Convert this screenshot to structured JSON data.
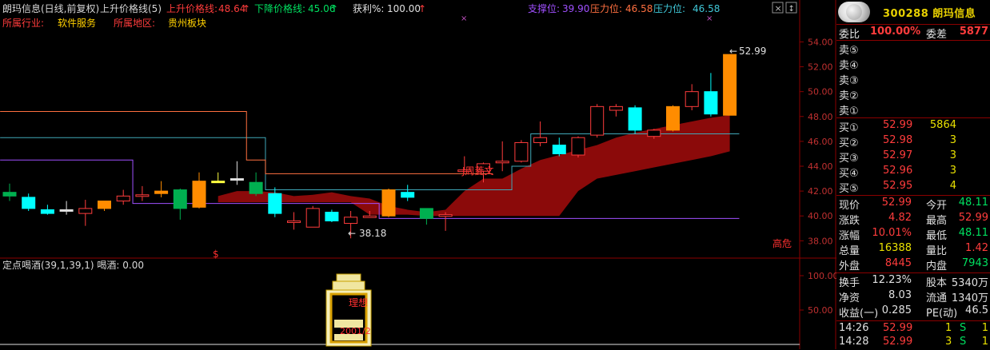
{
  "header": {
    "stock_title": "朗玛信息(日线,前复权)",
    "indicator_name": "上升价格线(5)",
    "up_price_label": "上升价格线:",
    "up_price_value": "48.64",
    "down_price_label": "下降价格线:",
    "down_price_value": "45.06",
    "profit_label": "获利%:",
    "profit_value": "100.00",
    "support_label": "支撑位:",
    "support_value": "39.90",
    "pressure_label": "压力位:",
    "pressure_value": "46.58",
    "pressure2_label": "压力位:",
    "pressure2_value": "46.58"
  },
  "info": {
    "industry_label": "所属行业:",
    "industry_value": "软件服务",
    "region_label": "所属地区:",
    "region_value": "贵州板块"
  },
  "main_axis": {
    "ticks": [
      "54.00",
      "52.00",
      "50.00",
      "48.00",
      "46.00",
      "44.00",
      "42.00",
      "40.00",
      "38.00"
    ]
  },
  "annotations": {
    "high_price": "52.99",
    "low_price": "38.18",
    "signal_text": "J周菱文",
    "danger_text": "高危",
    "dollar_mark": "$",
    "x_mark_1": "×",
    "x_mark_2": "×"
  },
  "lower_panel": {
    "title": "定点喝酒(39,1,39,1) 喝酒: 0.00",
    "axis_ticks": [
      "100.00",
      "50.00"
    ],
    "bottle_label_1": "理想",
    "bottle_label_2": "2001/2"
  },
  "chart_data": {
    "type": "candlestick",
    "ylim": [
      36.8,
      54.8
    ],
    "candles": [
      {
        "o": 41.6,
        "h": 42.6,
        "l": 41.2,
        "c": 41.9,
        "color": "green"
      },
      {
        "o": 41.5,
        "h": 41.8,
        "l": 40.4,
        "c": 40.6,
        "color": "cyan"
      },
      {
        "o": 40.5,
        "h": 40.9,
        "l": 40.1,
        "c": 40.2,
        "color": "cyan"
      },
      {
        "o": 40.5,
        "h": 41.2,
        "l": 40.1,
        "c": 40.4,
        "color": "white"
      },
      {
        "o": 40.2,
        "h": 41.3,
        "l": 39.2,
        "c": 40.6,
        "color": "red"
      },
      {
        "o": 40.6,
        "h": 41.2,
        "l": 40.4,
        "c": 41.2,
        "color": "orange"
      },
      {
        "o": 41.2,
        "h": 42.1,
        "l": 40.9,
        "c": 41.6,
        "color": "red"
      },
      {
        "o": 41.6,
        "h": 42.4,
        "l": 41.2,
        "c": 41.7,
        "color": "red"
      },
      {
        "o": 41.8,
        "h": 42.8,
        "l": 41.5,
        "c": 42.0,
        "color": "orange"
      },
      {
        "o": 42.1,
        "h": 42.2,
        "l": 39.7,
        "c": 40.6,
        "color": "green"
      },
      {
        "o": 40.7,
        "h": 43.5,
        "l": 40.6,
        "c": 42.8,
        "color": "orange"
      },
      {
        "o": 42.8,
        "h": 43.5,
        "l": 42.7,
        "c": 42.8,
        "color": "yellow"
      },
      {
        "o": 42.9,
        "h": 44.4,
        "l": 42.5,
        "c": 43.0,
        "color": "white"
      },
      {
        "o": 42.7,
        "h": 43.5,
        "l": 41.6,
        "c": 41.8,
        "color": "green"
      },
      {
        "o": 41.8,
        "h": 42.3,
        "l": 39.9,
        "c": 40.2,
        "color": "cyan"
      },
      {
        "o": 39.6,
        "h": 40.3,
        "l": 38.9,
        "c": 39.6,
        "color": "red"
      },
      {
        "o": 39.1,
        "h": 40.8,
        "l": 39.1,
        "c": 40.6,
        "color": "red"
      },
      {
        "o": 40.3,
        "h": 40.5,
        "l": 39.5,
        "c": 39.6,
        "color": "cyan"
      },
      {
        "o": 39.4,
        "h": 40.4,
        "l": 38.2,
        "c": 39.9,
        "color": "red"
      },
      {
        "o": 40.0,
        "h": 40.4,
        "l": 39.9,
        "c": 40.0,
        "color": "red"
      },
      {
        "o": 40.0,
        "h": 42.2,
        "l": 39.9,
        "c": 42.1,
        "color": "orange"
      },
      {
        "o": 41.9,
        "h": 42.5,
        "l": 41.2,
        "c": 41.5,
        "color": "cyan"
      },
      {
        "o": 40.6,
        "h": 40.6,
        "l": 39.3,
        "c": 39.8,
        "color": "green"
      },
      {
        "o": 40.0,
        "h": 40.3,
        "l": 38.8,
        "c": 40.1,
        "color": "red"
      },
      {
        "o": 43.7,
        "h": 44.8,
        "l": 43.6,
        "c": 43.7,
        "color": "red"
      },
      {
        "o": 43.6,
        "h": 44.3,
        "l": 42.7,
        "c": 44.2,
        "color": "red"
      },
      {
        "o": 44.3,
        "h": 46.0,
        "l": 43.6,
        "c": 44.4,
        "color": "red"
      },
      {
        "o": 44.4,
        "h": 46.1,
        "l": 44.3,
        "c": 45.9,
        "color": "red"
      },
      {
        "o": 45.9,
        "h": 47.6,
        "l": 45.6,
        "c": 46.3,
        "color": "red"
      },
      {
        "o": 45.7,
        "h": 46.3,
        "l": 44.8,
        "c": 45.0,
        "color": "cyan"
      },
      {
        "o": 44.9,
        "h": 46.4,
        "l": 44.7,
        "c": 46.3,
        "color": "red"
      },
      {
        "o": 46.5,
        "h": 49.0,
        "l": 46.3,
        "c": 48.8,
        "color": "red"
      },
      {
        "o": 48.5,
        "h": 49.0,
        "l": 48.0,
        "c": 48.8,
        "color": "red"
      },
      {
        "o": 48.7,
        "h": 48.9,
        "l": 46.6,
        "c": 46.9,
        "color": "cyan"
      },
      {
        "o": 46.4,
        "h": 47.0,
        "l": 46.2,
        "c": 46.9,
        "color": "red"
      },
      {
        "o": 46.9,
        "h": 48.9,
        "l": 46.8,
        "c": 48.8,
        "color": "orange"
      },
      {
        "o": 48.8,
        "h": 50.6,
        "l": 48.5,
        "c": 50.0,
        "color": "red"
      },
      {
        "o": 48.2,
        "h": 51.5,
        "l": 48.0,
        "c": 50.0,
        "color": "cyan"
      },
      {
        "o": 48.1,
        "h": 53.0,
        "l": 48.1,
        "c": 52.99,
        "color": "orange"
      }
    ],
    "up_line": [
      48.4,
      48.4,
      48.4,
      48.4,
      48.4,
      48.4,
      48.4,
      48.4,
      48.4,
      48.4,
      48.4,
      48.4,
      48.4,
      44.5,
      43.4,
      43.4,
      43.4,
      43.4,
      43.4,
      43.4,
      43.4,
      43.4,
      43.4,
      43.4,
      43.4,
      43.4
    ],
    "down_line": [
      46.3,
      46.3,
      46.3,
      46.3,
      46.3,
      46.3,
      46.3,
      46.3,
      46.3,
      46.3,
      46.3,
      46.3,
      46.3,
      46.3,
      42.1,
      42.1,
      42.1,
      42.1,
      42.1,
      42.1,
      42.1,
      42.1,
      42.1,
      42.1,
      42.1,
      42.1,
      42.1,
      44.0,
      46.6,
      46.6,
      46.6,
      46.6,
      46.6,
      46.6,
      46.6,
      46.6,
      46.6,
      46.6,
      46.6
    ],
    "support_line": [
      44.5,
      44.5,
      44.5,
      44.5,
      44.5,
      44.5,
      44.5,
      41.0,
      41.0,
      41.0,
      41.0,
      41.0,
      41.0,
      41.0,
      41.0,
      41.0,
      41.0,
      41.0,
      41.0,
      41.0,
      39.8,
      39.8,
      39.8,
      39.8,
      39.8,
      39.8,
      39.8,
      39.8,
      39.8,
      39.8,
      39.8,
      39.8,
      39.8,
      39.8,
      39.8,
      39.8,
      39.8,
      39.8,
      39.8
    ],
    "band_upper": [
      null,
      null,
      null,
      null,
      null,
      null,
      null,
      null,
      null,
      null,
      null,
      41.6,
      42.0,
      42.0,
      41.9,
      41.6,
      41.7,
      41.9,
      41.6,
      41.4,
      40.8,
      40.5,
      40.3,
      40.5,
      42.0,
      43.0,
      43.0,
      43.8,
      44.5,
      44.9,
      45.3,
      45.7,
      46.3,
      46.7,
      47.0,
      47.3,
      47.6,
      47.9,
      48.1
    ],
    "band_lower": [
      null,
      null,
      null,
      null,
      null,
      null,
      null,
      null,
      null,
      null,
      null,
      41.1,
      41.1,
      41.1,
      41.1,
      41.1,
      41.1,
      41.1,
      41.1,
      40.1,
      40.1,
      40.1,
      40.0,
      40.0,
      40.0,
      40.0,
      40.0,
      40.0,
      40.0,
      40.0,
      42.0,
      43.0,
      43.3,
      43.6,
      43.9,
      44.2,
      44.5,
      44.8,
      45.2
    ],
    "lower_volume": [
      0,
      0,
      0,
      0,
      0,
      0,
      0,
      0,
      0,
      0,
      0,
      0,
      0,
      0,
      0,
      0,
      0,
      0,
      0,
      0,
      0,
      0,
      0,
      0,
      0,
      0,
      0,
      0,
      0,
      0,
      0,
      0,
      0,
      0,
      0,
      0,
      0,
      0,
      0
    ]
  },
  "panel": {
    "logo_title": "300288 朗玛信息",
    "wei_bi_label": "委比",
    "wei_bi_value": "100.00%",
    "wei_cha_label": "委差",
    "wei_cha_value": "5877",
    "sell": [
      {
        "label": "卖⑤",
        "price": "",
        "vol": ""
      },
      {
        "label": "卖④",
        "price": "",
        "vol": ""
      },
      {
        "label": "卖③",
        "price": "",
        "vol": ""
      },
      {
        "label": "卖②",
        "price": "",
        "vol": ""
      },
      {
        "label": "卖①",
        "price": "",
        "vol": ""
      }
    ],
    "buy": [
      {
        "label": "买①",
        "price": "52.99",
        "vol": "5864"
      },
      {
        "label": "买②",
        "price": "52.98",
        "vol": "3"
      },
      {
        "label": "买③",
        "price": "52.97",
        "vol": "3"
      },
      {
        "label": "买④",
        "price": "52.96",
        "vol": "3"
      },
      {
        "label": "买⑤",
        "price": "52.95",
        "vol": "4"
      }
    ],
    "quote": [
      {
        "l1": "现价",
        "v1": "52.99",
        "c1": "red",
        "l2": "今开",
        "v2": "48.11",
        "c2": "grn"
      },
      {
        "l1": "涨跌",
        "v1": "4.82",
        "c1": "red",
        "l2": "最高",
        "v2": "52.99",
        "c2": "red"
      },
      {
        "l1": "涨幅",
        "v1": "10.01%",
        "c1": "red",
        "l2": "最低",
        "v2": "48.11",
        "c2": "grn"
      },
      {
        "l1": "总量",
        "v1": "16388",
        "c1": "yel",
        "l2": "量比",
        "v2": "1.42",
        "c2": "red"
      },
      {
        "l1": "外盘",
        "v1": "8445",
        "c1": "red",
        "l2": "内盘",
        "v2": "7943",
        "c2": "grn"
      }
    ],
    "stats": [
      {
        "l1": "换手",
        "v1": "12.23%",
        "l2": "股本",
        "v2": "5340万"
      },
      {
        "l1": "净资",
        "v1": "8.03",
        "l2": "流通",
        "v2": "1340万"
      },
      {
        "l1": "收益(一)",
        "v1": "0.285",
        "l2": "PE(动)",
        "v2": "46.5"
      }
    ],
    "ticks": [
      {
        "time": "14:26",
        "price": "52.99",
        "vol": "1",
        "side": "S",
        "n": "1"
      },
      {
        "time": "14:28",
        "price": "52.99",
        "vol": "3",
        "side": "S",
        "n": "1"
      }
    ]
  }
}
